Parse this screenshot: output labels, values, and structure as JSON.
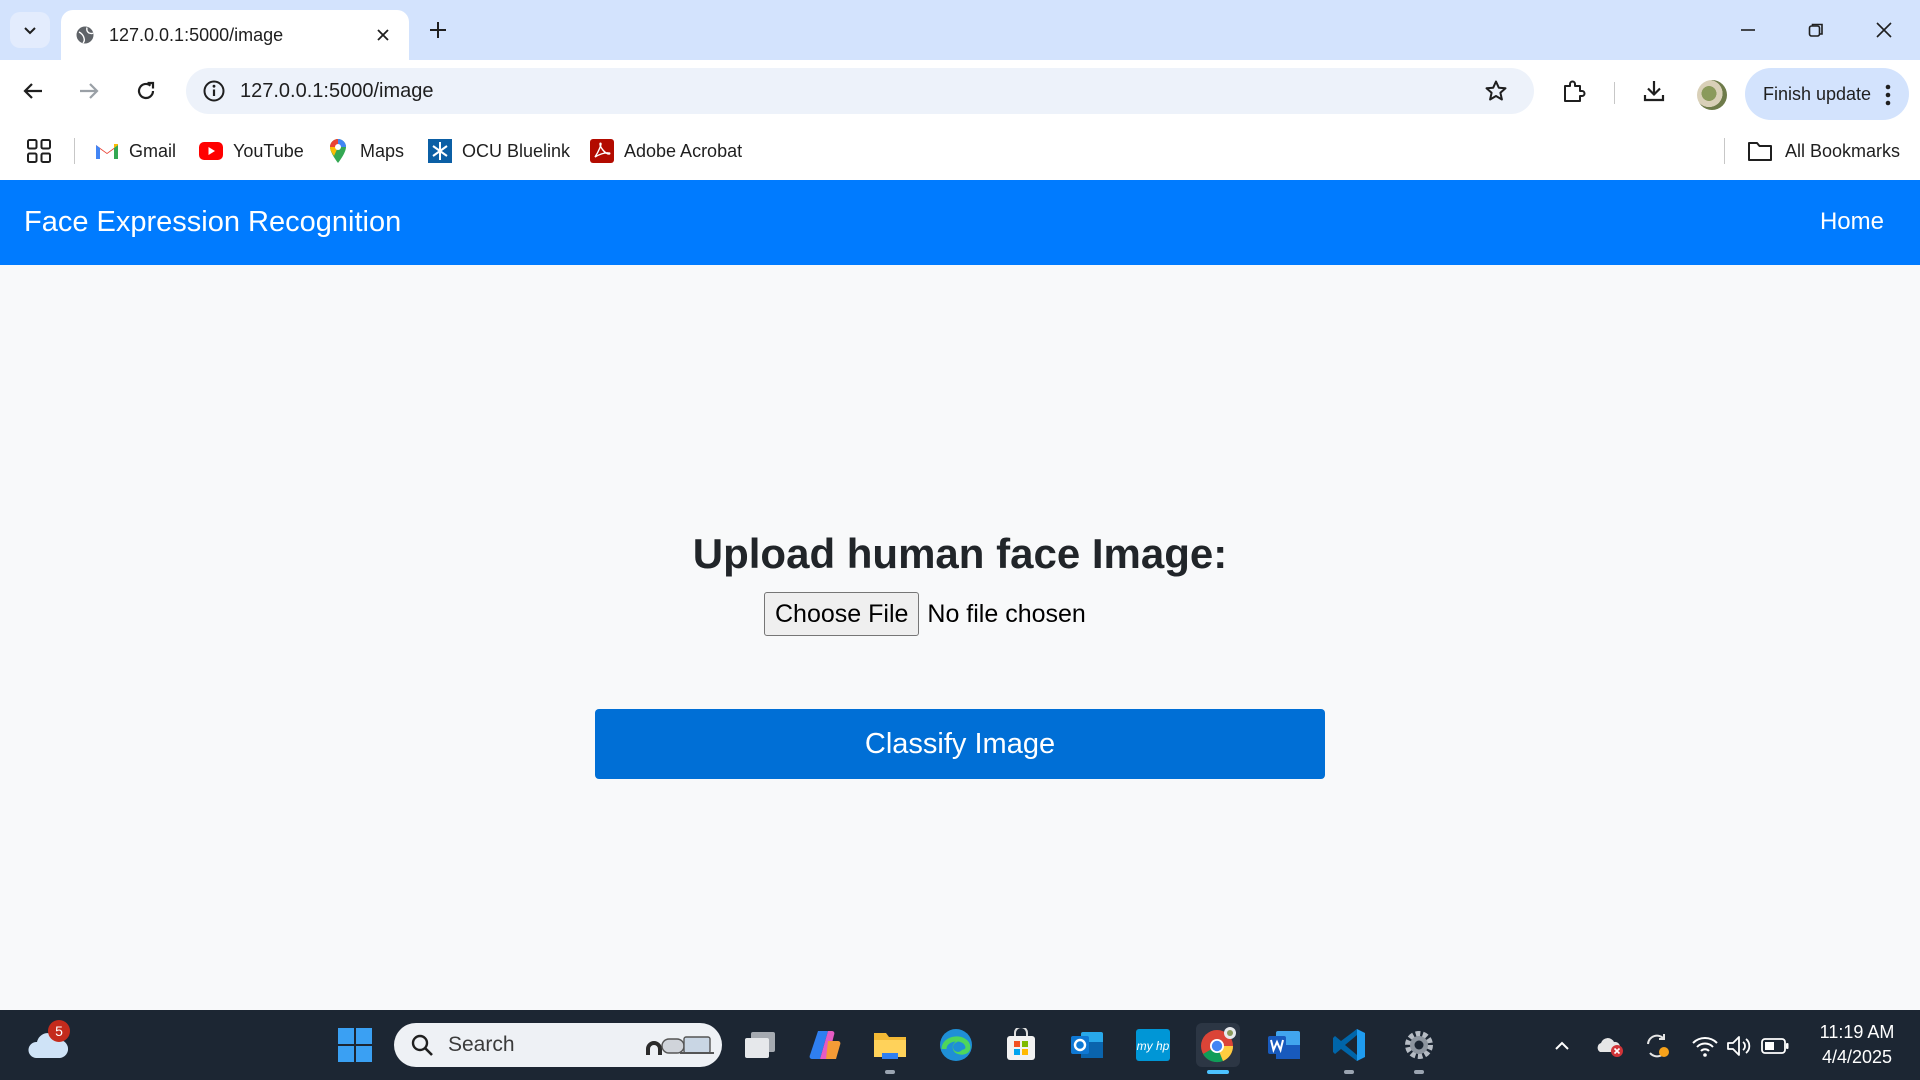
{
  "browser": {
    "tab_title": "127.0.0.1:5000/image",
    "url": "127.0.0.1:5000/image",
    "finish_update_label": "Finish update"
  },
  "bookmarks": {
    "items": [
      {
        "label": "Gmail",
        "icon": "gmail-icon"
      },
      {
        "label": "YouTube",
        "icon": "youtube-icon"
      },
      {
        "label": "Maps",
        "icon": "maps-icon"
      },
      {
        "label": "OCU Bluelink",
        "icon": "ocu-bluelink-icon"
      },
      {
        "label": "Adobe Acrobat",
        "icon": "adobe-acrobat-icon"
      }
    ],
    "all_bookmarks_label": "All Bookmarks"
  },
  "app": {
    "brand": "Face Expression Recognition",
    "nav_home": "Home",
    "upload_heading": "Upload human face Image:",
    "choose_file_label": "Choose File",
    "no_file_text": "No file chosen",
    "classify_button": "Classify Image",
    "colors": {
      "navbar": "#007bff",
      "button": "#006fd6",
      "background": "#f8f9fa"
    }
  },
  "taskbar": {
    "weather_badge": "5",
    "search_placeholder": "Search",
    "clock_time": "11:19 AM",
    "clock_date": "4/4/2025"
  }
}
